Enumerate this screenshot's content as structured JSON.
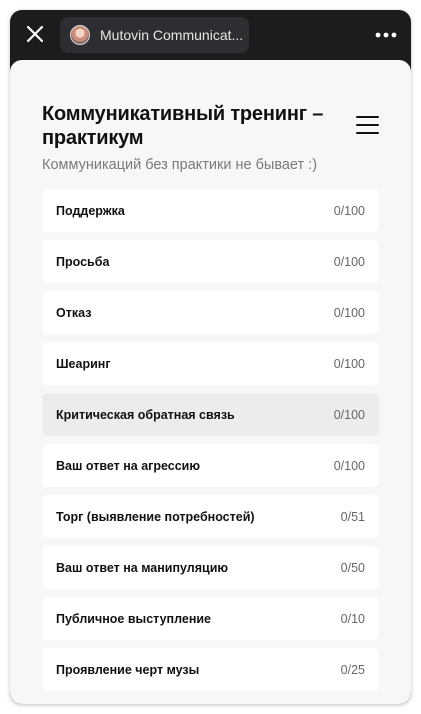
{
  "topbar": {
    "app_name": "Mutovin Communicat...",
    "close_icon": "close-icon",
    "more_icon": "more-horizontal-icon"
  },
  "header": {
    "title": "Коммуникативный тренинг – практикум",
    "subtitle": "Коммуникаций без практики не бывает :)",
    "menu_icon": "hamburger-menu-icon"
  },
  "items": [
    {
      "label": "Поддержка",
      "count": "0/100"
    },
    {
      "label": "Просьба",
      "count": "0/100"
    },
    {
      "label": "Отказ",
      "count": "0/100"
    },
    {
      "label": "Шеаринг",
      "count": "0/100"
    },
    {
      "label": "Критическая обратная связь",
      "count": "0/100"
    },
    {
      "label": "Ваш ответ на агрессию",
      "count": "0/100"
    },
    {
      "label": "Торг (выявление потребностей)",
      "count": "0/51"
    },
    {
      "label": "Ваш ответ на манипуляцию",
      "count": "0/50"
    },
    {
      "label": "Публичное выступление",
      "count": "0/10"
    },
    {
      "label": "Проявление черт музы",
      "count": "0/25"
    }
  ],
  "colors": {
    "topbar_bg": "#1c1c1e",
    "content_bg": "#f7f7f7",
    "item_bg": "#ffffff",
    "item_active_bg": "#ececec"
  }
}
